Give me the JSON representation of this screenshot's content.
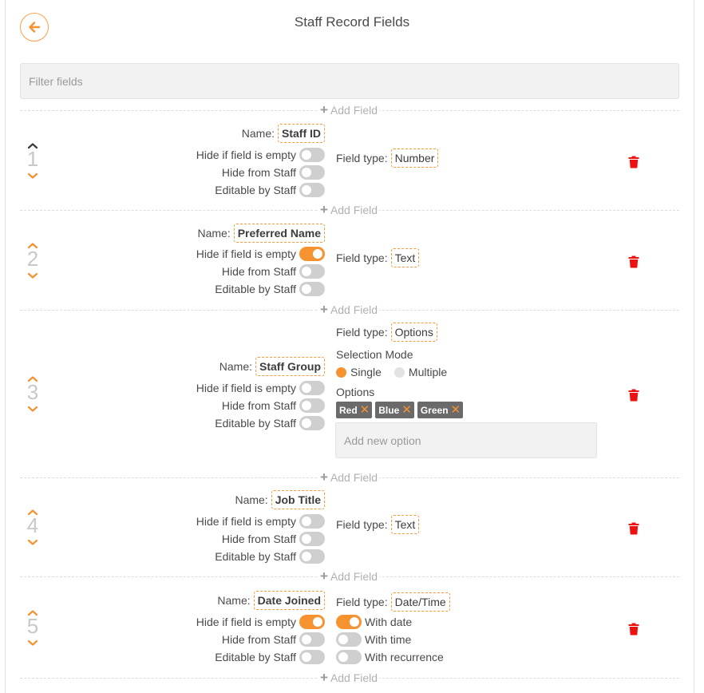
{
  "header": {
    "title": "Staff Record Fields",
    "back_icon": "arrow-left-circle-icon"
  },
  "filter": {
    "placeholder": "Filter fields",
    "value": ""
  },
  "add_field_label": "Add Field",
  "labels": {
    "name": "Name:",
    "field_type": "Field type:",
    "hide_if_empty": "Hide if field is empty",
    "hide_from_staff": "Hide from Staff",
    "editable_by_staff": "Editable by Staff",
    "selection_mode": "Selection Mode",
    "single": "Single",
    "multiple": "Multiple",
    "options": "Options",
    "add_new_option_placeholder": "Add new option",
    "with_date": "With date",
    "with_time": "With time",
    "with_recurrence": "With recurrence"
  },
  "colors": {
    "accent": "#f6922f",
    "delete": "#ee1111",
    "toggle_off": "#cfcfcf"
  },
  "fields": [
    {
      "index": "1",
      "name": "Staff ID",
      "type": "Number",
      "hide_if_empty": false,
      "hide_from_staff": false,
      "editable_by_staff": false,
      "can_move_up": false,
      "can_move_down": true
    },
    {
      "index": "2",
      "name": "Preferred Name",
      "type": "Text",
      "hide_if_empty": true,
      "hide_from_staff": false,
      "editable_by_staff": false,
      "can_move_up": true,
      "can_move_down": true
    },
    {
      "index": "3",
      "name": "Staff Group",
      "type": "Options",
      "hide_if_empty": false,
      "hide_from_staff": false,
      "editable_by_staff": false,
      "can_move_up": true,
      "can_move_down": true,
      "selection_mode": "Single",
      "options": [
        "Red",
        "Blue",
        "Green"
      ]
    },
    {
      "index": "4",
      "name": "Job Title",
      "type": "Text",
      "hide_if_empty": false,
      "hide_from_staff": false,
      "editable_by_staff": false,
      "can_move_up": true,
      "can_move_down": true
    },
    {
      "index": "5",
      "name": "Date Joined",
      "type": "Date/Time",
      "hide_if_empty": true,
      "hide_from_staff": false,
      "editable_by_staff": false,
      "can_move_up": true,
      "can_move_down": true,
      "with_date": true,
      "with_time": false,
      "with_recurrence": false
    }
  ]
}
